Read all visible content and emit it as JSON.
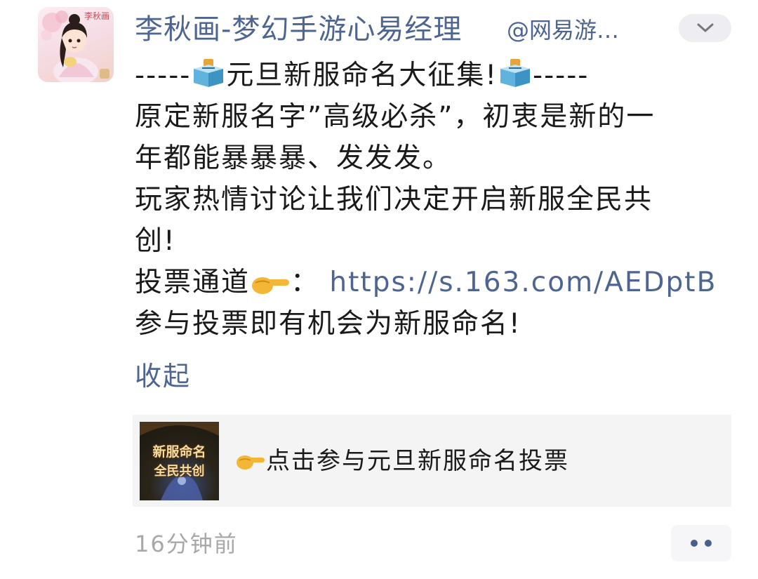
{
  "header": {
    "name": "李秋画-梦幻手游心易经理",
    "handle": "@网易游…",
    "avatar_caption": "李秋画"
  },
  "post": {
    "lines": [
      {
        "segments": [
          {
            "t": "text",
            "v": "-----"
          },
          {
            "t": "emoji",
            "icon": "ballot-box-icon"
          },
          {
            "t": "text",
            "v": "元旦新服命名大征集!"
          },
          {
            "t": "emoji",
            "icon": "ballot-box-icon"
          },
          {
            "t": "text",
            "v": "-----"
          }
        ]
      },
      {
        "segments": [
          {
            "t": "text",
            "v": "原定新服名字”高级必杀”，初衷是新的一"
          }
        ]
      },
      {
        "segments": [
          {
            "t": "text",
            "v": "年都能暴暴暴、发发发。"
          }
        ]
      },
      {
        "segments": [
          {
            "t": "text",
            "v": "玩家热情讨论让我们决定开启新服全民共"
          }
        ]
      },
      {
        "segments": [
          {
            "t": "text",
            "v": "创!"
          }
        ]
      },
      {
        "segments": [
          {
            "t": "text",
            "v": "投票通道"
          },
          {
            "t": "emoji",
            "icon": "pointing-hand-icon"
          },
          {
            "t": "text",
            "v": "： "
          },
          {
            "t": "link",
            "v": "https://s.163.com/AEDptB"
          }
        ]
      },
      {
        "segments": [
          {
            "t": "text",
            "v": "参与投票即有机会为新服命名!"
          }
        ]
      }
    ],
    "collapse_label": "收起"
  },
  "card": {
    "thumb_line1": "新服命名",
    "thumb_line2": "全民共创",
    "text": "点击参与元旦新服命名投票"
  },
  "footer": {
    "time": "16分钟前"
  },
  "colors": {
    "link": "#4d6590",
    "time": "#a8a8a8",
    "card_bg": "#f4f4f4"
  }
}
